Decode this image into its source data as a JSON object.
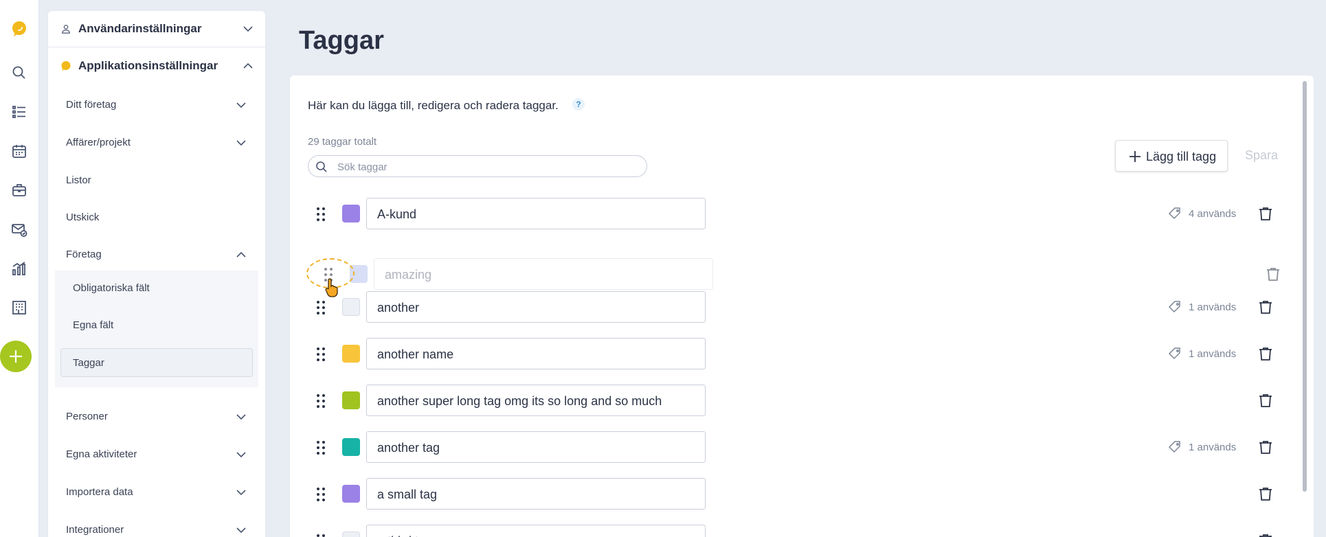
{
  "colors": {
    "brand": "#f2b91b",
    "accent_green": "#a6c71f",
    "purple": "#9a82e6",
    "light": "#edf1f6",
    "yellow": "#f8c53a",
    "lime": "#a0c320",
    "teal": "#17b3a6"
  },
  "rail": {
    "icons": [
      "logo-icon",
      "search-icon",
      "list-icon",
      "calendar-icon",
      "briefcase-icon",
      "mail-settings-icon",
      "chart-icon",
      "building-icon",
      "add-icon"
    ]
  },
  "sidebar": {
    "user_settings": "Användarinställningar",
    "app_settings": "Applikationsinställningar",
    "items": [
      {
        "label": "Ditt företag"
      },
      {
        "label": "Affärer/projekt"
      },
      {
        "label": "Listor"
      },
      {
        "label": "Utskick"
      },
      {
        "label": "Företag"
      },
      {
        "label": "Personer"
      },
      {
        "label": "Egna aktiviteter"
      },
      {
        "label": "Importera data"
      },
      {
        "label": "Integrationer"
      }
    ],
    "sub_items": [
      {
        "label": "Obligatoriska fält"
      },
      {
        "label": "Egna fält"
      },
      {
        "label": "Taggar"
      }
    ]
  },
  "page": {
    "title": "Taggar",
    "intro": "Här kan du lägga till, redigera och radera taggar.",
    "help": "?",
    "count": "29 taggar totalt",
    "search_placeholder": "Sök taggar",
    "add_tag": "Lägg till tagg",
    "save": "Spara"
  },
  "tags": [
    {
      "name": "A-kund",
      "color": "#9a82e6",
      "usage": "4 används"
    },
    {
      "name": "amazing",
      "color": "#b8c4f0",
      "usage": "",
      "dragging": true
    },
    {
      "name": "another",
      "color": "#edf1f6",
      "usage": "1 används"
    },
    {
      "name": "another name",
      "color": "#f8c53a",
      "usage": "1 används"
    },
    {
      "name": "another super long tag omg its so long and so much",
      "color": "#a0c320",
      "usage": ""
    },
    {
      "name": "another tag",
      "color": "#17b3a6",
      "usage": "1 används"
    },
    {
      "name": "a small tag",
      "color": "#9a82e6",
      "usage": ""
    },
    {
      "name": "a third tag",
      "color": "#edf1f6",
      "usage": ""
    }
  ]
}
